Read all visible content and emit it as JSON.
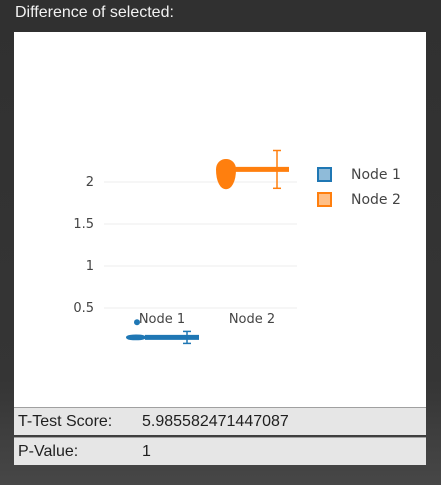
{
  "panel": {
    "title": "Difference of selected:"
  },
  "chart_data": {
    "type": "violin",
    "orientation": "horizontal",
    "categories": [
      "Node 1",
      "Node 2"
    ],
    "y_ticks": [
      "0.5",
      "1",
      "1.5",
      "2"
    ],
    "y_tick_values": [
      0.5,
      1,
      1.5,
      2
    ],
    "ylim": [
      0,
      2.5
    ],
    "grid": true,
    "legend_position": "right",
    "series": [
      {
        "name": "Node 1",
        "color": "#1f77b4",
        "values": [
          0.12,
          0.15,
          0.18,
          0.14,
          0.16,
          0.13,
          0.17,
          0.15,
          0.14,
          0.16,
          0.33
        ],
        "mean": 0.15,
        "outliers": [
          0.33
        ]
      },
      {
        "name": "Node 2",
        "color": "#ff7f0e",
        "values": [
          1.85,
          1.9,
          2.0,
          2.1,
          2.15,
          2.2,
          2.25,
          2.3,
          2.18,
          2.12
        ],
        "mean": 2.15
      }
    ]
  },
  "stats": {
    "t_test": {
      "label": "T-Test Score:",
      "value": "5.985582471447087"
    },
    "p_value": {
      "label": "P-Value:",
      "value": "1"
    }
  }
}
